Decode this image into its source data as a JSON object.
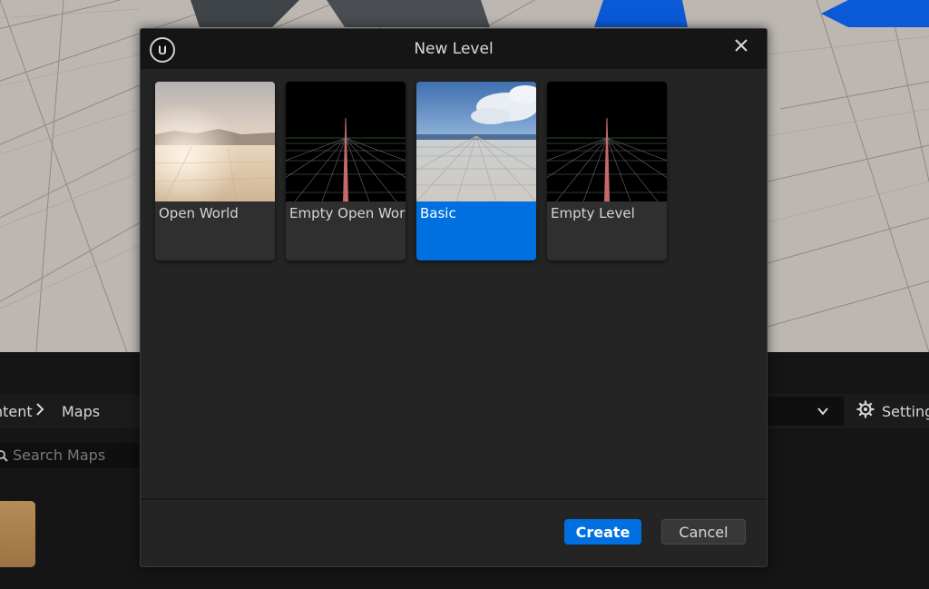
{
  "dialog": {
    "title": "New Level",
    "templates": [
      {
        "label": "Open World",
        "selected": false,
        "thumbnail": "open-world-desert-sky"
      },
      {
        "label": "Empty Open World",
        "selected": false,
        "thumbnail": "black-grid-horizon"
      },
      {
        "label": "Basic",
        "selected": true,
        "thumbnail": "sky-tiled-floor"
      },
      {
        "label": "Empty Level",
        "selected": false,
        "thumbnail": "black-grid-horizon"
      }
    ],
    "create_label": "Create",
    "cancel_label": "Cancel"
  },
  "content_browser": {
    "breadcrumb": [
      "Content",
      "Maps"
    ],
    "settings_label": "Settings",
    "search_placeholder": "Search Maps"
  },
  "colors": {
    "accent": "#0070e0",
    "dialog_bg": "#242424",
    "title_bar_bg": "#151515"
  },
  "icons": [
    "unreal-logo-icon",
    "close-icon",
    "chevron-right-icon",
    "chevron-down-icon",
    "gear-icon",
    "search-icon"
  ]
}
